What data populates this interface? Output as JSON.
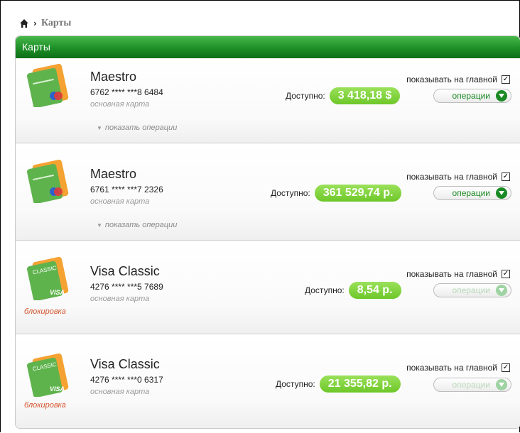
{
  "breadcrumb": {
    "current": "Карты"
  },
  "panel": {
    "title": "Карты"
  },
  "labels": {
    "available": "Доступно:",
    "show_on_main": "показывать на главной",
    "operations": "операции",
    "show_operations": "показать операции",
    "blocked": "блокировка"
  },
  "cards": [
    {
      "name": "Maestro",
      "number": "6762 **** ***8 6484",
      "type_note": "основная карта",
      "amount": "3 418,18 $",
      "brand": "maestro",
      "blocked": false,
      "show_on_main": true,
      "operations_enabled": true,
      "has_operations_link": true
    },
    {
      "name": "Maestro",
      "number": "6761 **** ***7 2326",
      "type_note": "основная карта",
      "amount": "361 529,74 р.",
      "brand": "maestro",
      "blocked": false,
      "show_on_main": true,
      "operations_enabled": true,
      "has_operations_link": true
    },
    {
      "name": "Visa Classic",
      "number": "4276 **** ***5 7689",
      "type_note": "основная карта",
      "amount": "8,54 р.",
      "brand": "visa-classic",
      "blocked": true,
      "show_on_main": true,
      "operations_enabled": false,
      "has_operations_link": false
    },
    {
      "name": "Visa Classic",
      "number": "4276 **** ***0 6317",
      "type_note": "основная карта",
      "amount": "21 355,82 р.",
      "brand": "visa-classic",
      "blocked": true,
      "show_on_main": true,
      "operations_enabled": false,
      "has_operations_link": false
    }
  ],
  "colors": {
    "header_green": "#1e8f27",
    "pill_green": "#7ccf33",
    "blocked_red": "#d4522a"
  }
}
